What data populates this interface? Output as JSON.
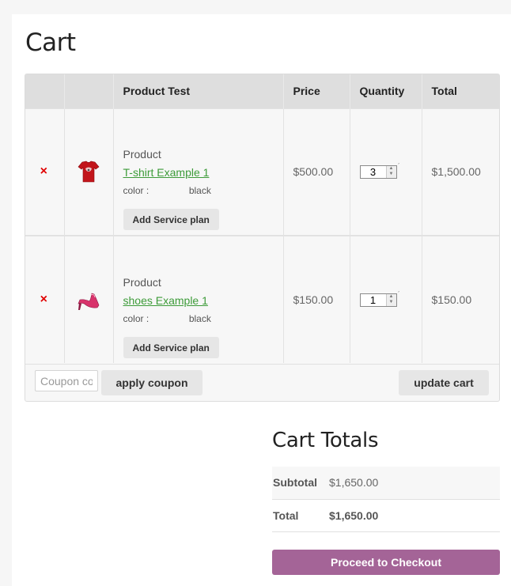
{
  "page": {
    "title": "Cart"
  },
  "cart_table": {
    "headers": [
      "",
      "",
      "Product Test",
      "Price",
      "Quantity",
      "Total"
    ],
    "rows": [
      {
        "remove_glyph": "×",
        "thumb_icon": "red-tshirt-icon",
        "product_label": "Product",
        "product_name": "T-shirt Example 1",
        "meta_key": "color :",
        "meta_value": "black",
        "service_label": "Add Service plan",
        "price": "$500.00",
        "quantity": "3",
        "total": "$1,500.00"
      },
      {
        "remove_glyph": "×",
        "thumb_icon": "high-heel-shoe-icon",
        "product_label": "Product",
        "product_name": "shoes Example 1",
        "meta_key": "color :",
        "meta_value": "black",
        "service_label": "Add Service plan",
        "price": "$150.00",
        "quantity": "1",
        "total": "$150.00"
      }
    ]
  },
  "actions": {
    "coupon_placeholder": "Coupon code",
    "apply_label": "apply coupon",
    "update_label": "update cart"
  },
  "totals": {
    "title": "Cart Totals",
    "subtotal_label": "Subtotal",
    "subtotal_value": "$1,650.00",
    "total_label": "Total",
    "total_value": "$1,650.00",
    "checkout_label": "Proceed to Checkout"
  },
  "colors": {
    "link": "#3d9b39",
    "remove": "#e00000",
    "checkout": "#a46497"
  }
}
